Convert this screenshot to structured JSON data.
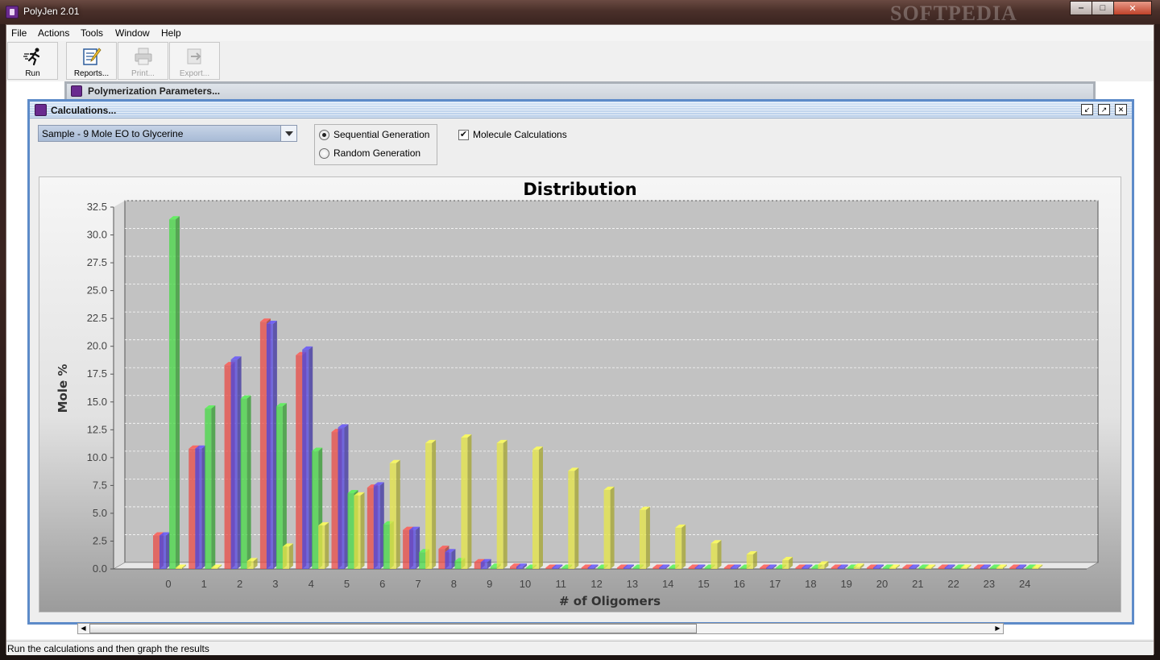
{
  "app": {
    "title": "PolyJen 2.01",
    "watermark": "SOFTPEDIA",
    "window_controls": {
      "minimize": "‒",
      "maximize": "□",
      "close": "✕"
    }
  },
  "menubar": {
    "items": [
      {
        "label": "File"
      },
      {
        "label": "Actions"
      },
      {
        "label": "Tools"
      },
      {
        "label": "Window"
      },
      {
        "label": "Help"
      }
    ]
  },
  "toolbar": {
    "buttons": [
      {
        "label": "Run",
        "icon": "running-man-icon",
        "enabled": true
      },
      {
        "label": "Reports...",
        "icon": "report-pencil-icon",
        "enabled": true
      },
      {
        "label": "Print...",
        "icon": "printer-icon",
        "enabled": false
      },
      {
        "label": "Export...",
        "icon": "export-arrow-icon",
        "enabled": false
      }
    ]
  },
  "frames": {
    "background": {
      "title": "Polymerization Parameters..."
    },
    "front": {
      "title": "Calculations..."
    },
    "frame_buttons": {
      "iconify": "↙",
      "maximize": "↗",
      "close": "✕"
    }
  },
  "controls": {
    "sample_select": {
      "value": "Sample - 9 Mole EO to Glycerine"
    },
    "generation": {
      "options": [
        {
          "label": "Sequential Generation",
          "selected": true
        },
        {
          "label": "Random Generation",
          "selected": false
        }
      ]
    },
    "molecule_calculations": {
      "label": "Molecule Calculations",
      "checked": true,
      "mark": "✔"
    }
  },
  "statusbar": {
    "text": "Run the calculations and then graph the results"
  },
  "chart_data": {
    "type": "bar",
    "title": "Distribution",
    "xlabel": "# of Oligomers",
    "ylabel": "Mole %",
    "categories": [
      "0",
      "1",
      "2",
      "3",
      "4",
      "5",
      "6",
      "7",
      "8",
      "9",
      "10",
      "11",
      "12",
      "13",
      "14",
      "15",
      "16",
      "17",
      "18",
      "19",
      "20",
      "21",
      "22",
      "23",
      "24"
    ],
    "ylim": [
      0,
      32.5
    ],
    "yticks": [
      "0.0",
      "2.5",
      "5.0",
      "7.5",
      "10.0",
      "12.5",
      "15.0",
      "17.5",
      "20.0",
      "22.5",
      "25.0",
      "27.5",
      "30.0",
      "32.5"
    ],
    "grid": true,
    "legend": "none",
    "series_colors": [
      "#e8504a",
      "#5a4ce0",
      "#4cd94a",
      "#e6e64a"
    ],
    "series": [
      {
        "values": [
          3.0,
          10.8,
          18.3,
          22.2,
          19.2,
          12.3,
          7.3,
          3.5,
          1.8,
          0.6,
          0.2,
          0,
          0,
          0,
          0,
          0,
          0,
          0,
          0,
          0,
          0,
          0,
          0,
          0,
          0
        ]
      },
      {
        "values": [
          3.0,
          10.8,
          18.8,
          22.0,
          19.7,
          12.7,
          7.5,
          3.5,
          1.5,
          0.6,
          0.2,
          0,
          0,
          0,
          0,
          0,
          0,
          0,
          0,
          0,
          0,
          0,
          0,
          0,
          0
        ]
      },
      {
        "values": [
          31.4,
          14.4,
          15.3,
          14.6,
          10.6,
          6.8,
          4.0,
          1.5,
          0.7,
          0.2,
          0,
          0,
          0,
          0,
          0,
          0,
          0,
          0,
          0,
          0,
          0,
          0,
          0,
          0,
          0
        ]
      },
      {
        "values": [
          0.0,
          0.1,
          0.7,
          2.0,
          3.9,
          6.6,
          9.5,
          11.3,
          11.8,
          11.3,
          10.7,
          8.8,
          7.1,
          5.3,
          3.7,
          2.3,
          1.3,
          0.8,
          0.4,
          0.2,
          0.1,
          0,
          0,
          0,
          0
        ]
      }
    ]
  }
}
